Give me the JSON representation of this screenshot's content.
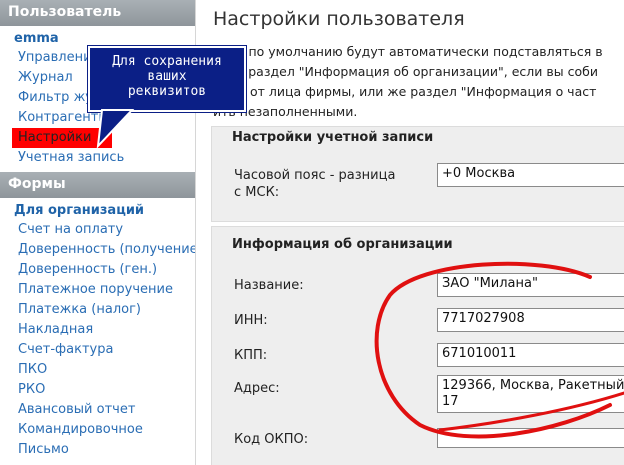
{
  "sidebar": {
    "user_header": "Пользователь",
    "user_name": "emma",
    "user_items": [
      {
        "label": "Управление"
      },
      {
        "label": "Журнал"
      },
      {
        "label": "Фильтр журнала"
      },
      {
        "label": "Контрагенты"
      },
      {
        "label": "Настройки",
        "active": true
      },
      {
        "label": "Учетная запись"
      }
    ],
    "forms_header": "Формы",
    "forms_group": "Для организаций",
    "forms_items": [
      {
        "label": "Счет на оплату"
      },
      {
        "label": "Доверенность (получение)"
      },
      {
        "label": "Доверенность (ген.)"
      },
      {
        "label": "Платежное поручение"
      },
      {
        "label": "Платежка (налог)"
      },
      {
        "label": "Накладная"
      },
      {
        "label": "Счет-фактура"
      },
      {
        "label": "ПКО"
      },
      {
        "label": "РКО"
      },
      {
        "label": "Авансовый отчет"
      },
      {
        "label": "Командировочное"
      },
      {
        "label": "Письмо"
      }
    ]
  },
  "main": {
    "title": "Настройки пользователя",
    "intro_lines": [
      "ения по умолчанию будут автоматически подставляться в",
      "ните раздел \"Информация об организации\", если вы соби",
      "енты от лица фирмы, или же раздел \"Информация о част",
      "ить незаполненными."
    ],
    "account_section": {
      "legend": "Настройки учетной записи",
      "timezone_label": "Часовой пояс - разница с МСК:",
      "timezone_value": "+0 Москва"
    },
    "org_section": {
      "legend": "Информация об организации",
      "name_label": "Название:",
      "name_value": "ЗАО \"Милана\"",
      "inn_label": "ИНН:",
      "inn_value": "7717027908",
      "kpp_label": "КПП:",
      "kpp_value": "671010011",
      "address_label": "Адрес:",
      "address_value": "129366, Москва, Ракетный 17",
      "okpo_label": "Код ОКПО:",
      "okpo_value": ""
    }
  },
  "callout": {
    "lines": [
      "Для сохранения",
      "ваших",
      "реквизитов"
    ]
  },
  "colors": {
    "sidebar_header": "#9aa1a7",
    "link": "#2a6db4",
    "active_bg": "#ff0000",
    "callout_bg": "#0b1f86",
    "annotation": "#e01010"
  }
}
